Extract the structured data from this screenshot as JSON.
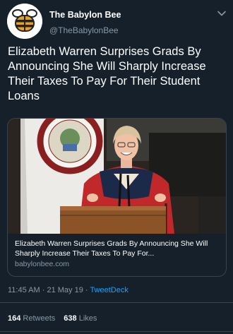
{
  "account": {
    "display_name": "The Babylon Bee",
    "handle": "@TheBabylonBee"
  },
  "tweet": {
    "text": "Elizabeth Warren Surprises Grads By Announcing She Will Sharply Increase Their Taxes To Pay For Their Student Loans"
  },
  "card": {
    "title": "Elizabeth Warren Surprises Grads By Announcing She Will Sharply Increase Their Taxes To Pay For...",
    "domain": "babylonbee.com",
    "image_description_icon": "photo-of-speaker-at-podium-icon"
  },
  "meta": {
    "time": "11:45 AM",
    "separator": "·",
    "date": "21 May 19",
    "source": "TweetDeck"
  },
  "stats": {
    "retweets_count": "164",
    "retweets_label": "Retweets",
    "likes_count": "638",
    "likes_label": "Likes"
  },
  "colors": {
    "background": "#15202b",
    "secondary_text": "#8899a6",
    "accent": "#1da1f2",
    "border": "#38444d",
    "avatar_bee": "#e8a21a"
  },
  "icons": {
    "avatar": "babylon-bee-logo-icon",
    "more": "chevron-down-icon"
  }
}
